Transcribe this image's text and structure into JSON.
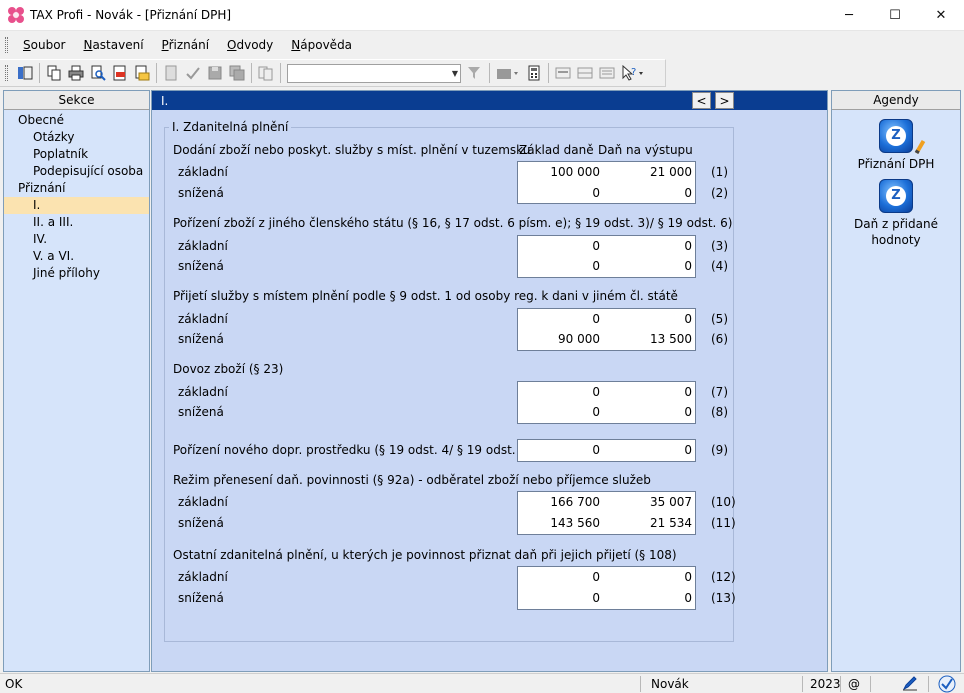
{
  "window": {
    "title": "TAX Profi - Novák - [Přiznání DPH]",
    "icons": {
      "app": "flower-app-icon",
      "minimize": "─",
      "maximize": "☐",
      "close": "✕"
    }
  },
  "menu": {
    "items": [
      {
        "underline": "S",
        "rest": "oubor"
      },
      {
        "underline": "N",
        "rest": "astavení"
      },
      {
        "underline": "P",
        "rest": "řiznání"
      },
      {
        "underline": "O",
        "rest": "dvody"
      },
      {
        "underline": "N",
        "rest": "ápověda"
      }
    ]
  },
  "toolbar": {
    "combo_value": ""
  },
  "sekce": {
    "header": "Sekce",
    "items": [
      {
        "label": "Obecné",
        "level": 1
      },
      {
        "label": "Otázky",
        "level": 2
      },
      {
        "label": "Poplatník",
        "level": 2
      },
      {
        "label": "Podepisující osoba",
        "level": 2
      },
      {
        "label": "Přiznání",
        "level": 1
      },
      {
        "label": "I.",
        "level": 2,
        "selected": true
      },
      {
        "label": "II. a III.",
        "level": 2
      },
      {
        "label": "IV.",
        "level": 2
      },
      {
        "label": "V. a VI.",
        "level": 2
      },
      {
        "label": "Jiné přílohy",
        "level": 2
      }
    ]
  },
  "main": {
    "header": "I.",
    "nav_prev": "<",
    "nav_next": ">",
    "group_title": "I. Zdanitelná plnění",
    "col_base": "Základ daně",
    "col_tax": "Daň na výstupu",
    "sections": [
      {
        "title": "Dodání zboží nebo poskyt. služby s míst. plnění v tuzemsku",
        "rows": [
          {
            "label": "základní",
            "base": "100 000",
            "tax": "21 000",
            "num": "(1)"
          },
          {
            "label": "snížená",
            "base": "0",
            "tax": "0",
            "num": "(2)"
          }
        ]
      },
      {
        "title": "Pořízení zboží z jiného členského státu (§ 16, § 17 odst. 6 písm. e); § 19 odst. 3)/ § 19 odst. 6)",
        "rows": [
          {
            "label": "základní",
            "base": "0",
            "tax": "0",
            "num": "(3)"
          },
          {
            "label": "snížená",
            "base": "0",
            "tax": "0",
            "num": "(4)"
          }
        ]
      },
      {
        "title": "Přijetí služby s místem plnění podle § 9 odst. 1 od osoby reg. k dani v jiném čl. státě",
        "rows": [
          {
            "label": "základní",
            "base": "0",
            "tax": "0",
            "num": "(5)"
          },
          {
            "label": "snížená",
            "base": "90 000",
            "tax": "13 500",
            "num": "(6)"
          }
        ]
      },
      {
        "title": "Dovoz zboží (§ 23)",
        "rows": [
          {
            "label": "základní",
            "base": "0",
            "tax": "0",
            "num": "(7)"
          },
          {
            "label": "snížená",
            "base": "0",
            "tax": "0",
            "num": "(8)"
          }
        ]
      },
      {
        "title": "Pořízení nového dopr. prostředku (§ 19 odst. 4/ § 19 odst. 6)",
        "rows": [
          {
            "label": "",
            "base": "0",
            "tax": "0",
            "num": "(9)"
          }
        ]
      },
      {
        "title": "Režim přenesení daň. povinnosti (§ 92a) - odběratel zboží nebo příjemce služeb",
        "rows": [
          {
            "label": "základní",
            "base": "166 700",
            "tax": "35 007",
            "num": "(10)"
          },
          {
            "label": "snížená",
            "base": "143 560",
            "tax": "21 534",
            "num": "(11)"
          }
        ]
      },
      {
        "title": "Ostatní zdanitelná plnění, u kterých je povinnost přiznat daň při jejich přijetí (§ 108)",
        "rows": [
          {
            "label": "základní",
            "base": "0",
            "tax": "0",
            "num": "(12)"
          },
          {
            "label": "snížená",
            "base": "0",
            "tax": "0",
            "num": "(13)"
          }
        ]
      }
    ]
  },
  "agendy": {
    "header": "Agendy",
    "items": [
      {
        "label_line1": "Přiznání DPH",
        "label_line2": "",
        "icon": "dph-agenda-icon"
      },
      {
        "label_line1": "Daň z přidané",
        "label_line2": "hodnoty",
        "icon": "vat-agenda-icon"
      }
    ]
  },
  "status": {
    "left": "OK",
    "user": "Novák",
    "year": "2023",
    "at": "@"
  }
}
